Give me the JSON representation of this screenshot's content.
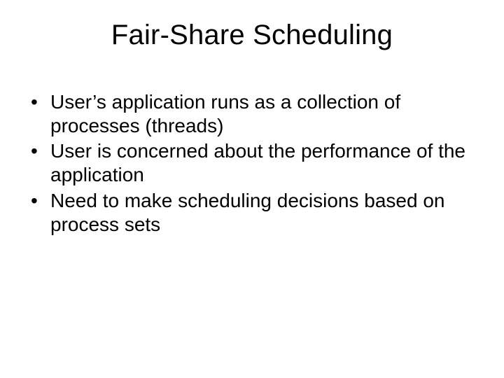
{
  "slide": {
    "title": "Fair-Share Scheduling",
    "bullets": [
      "User’s application runs as a collection of processes (threads)",
      "User is concerned about the performance of the application",
      "Need to make scheduling decisions based on process sets"
    ]
  }
}
